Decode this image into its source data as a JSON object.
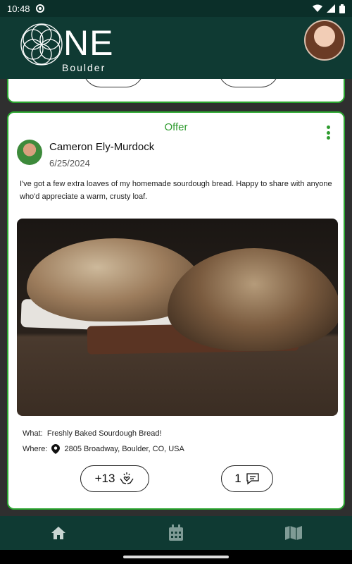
{
  "status_bar": {
    "time": "10:48"
  },
  "header": {
    "logo_word": "NE",
    "logo_sub": "Boulder"
  },
  "post": {
    "category": "Offer",
    "author": "Cameron Ely-Murdock",
    "date": "6/25/2024",
    "text": "I've got a few extra loaves of my homemade sourdough bread. Happy to share with anyone who'd appreciate a warm, crusty loaf.",
    "what_label": "What:",
    "what_value": "Freshly Baked Sourdough Bread!",
    "where_label": "Where:",
    "where_value": "2805 Broadway, Boulder, CO, USA",
    "appreciation_count": "+13",
    "comment_count": "1"
  },
  "icons": {
    "status": [
      "media-icon",
      "wifi-icon",
      "signal-icon",
      "battery-icon"
    ],
    "post": [
      "more-vert-icon",
      "location-pin-icon",
      "hands-heart-icon",
      "comment-icon"
    ],
    "nav": [
      "home-icon",
      "calendar-icon",
      "map-icon"
    ]
  },
  "colors": {
    "header_bg": "#0f3a33",
    "accent_green": "#2f9b2f",
    "card_border": "#2aa52f",
    "feed_bg": "#2f2f2f"
  }
}
